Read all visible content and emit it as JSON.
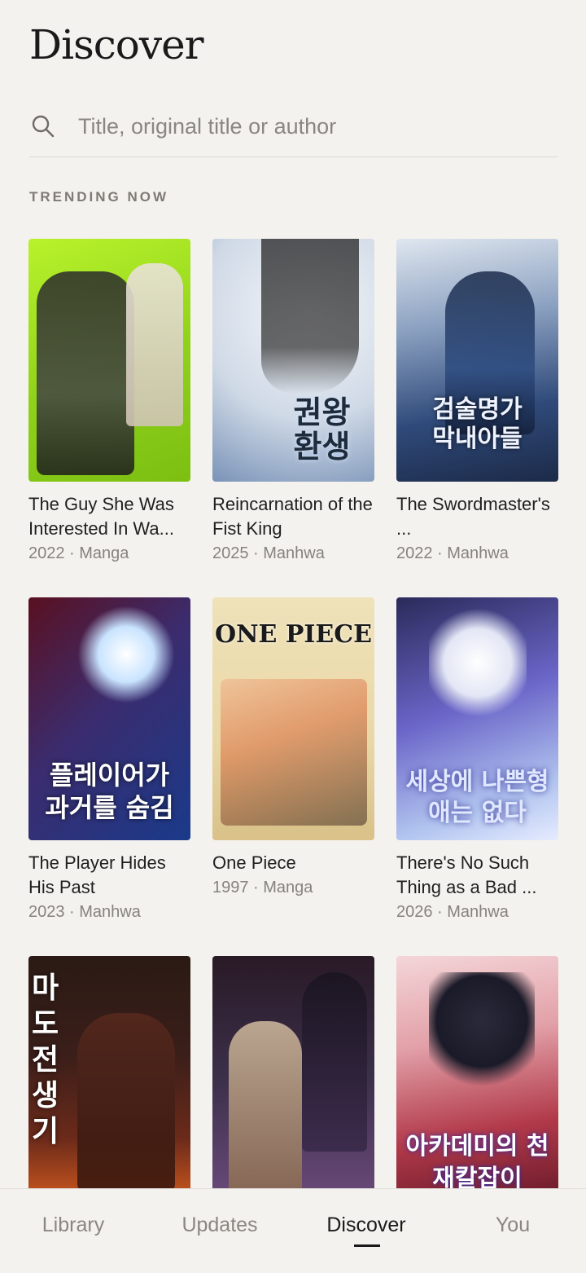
{
  "header": {
    "title": "Discover"
  },
  "search": {
    "placeholder": "Title, original title or author",
    "value": ""
  },
  "trending": {
    "label": "TRENDING NOW",
    "items": [
      {
        "title": "The Guy She Was Interested In Wasn't a Guy At All",
        "display_title": "The Guy She Was Interested In Wa...",
        "year": "2022",
        "type": "Manga",
        "meta": "2022 · Manga",
        "cover_text": ""
      },
      {
        "title": "Reincarnation of the Fist King",
        "display_title": "Reincarnation of the Fist King",
        "year": "2025",
        "type": "Manhwa",
        "meta": "2025 · Manhwa",
        "cover_text": "권왕 환생"
      },
      {
        "title": "The Swordmaster's Son",
        "display_title": "The Swordmaster's ...",
        "year": "2022",
        "type": "Manhwa",
        "meta": "2022 · Manhwa",
        "cover_text": "검술명가 막내아들"
      },
      {
        "title": "The Player Hides His Past",
        "display_title": "The Player Hides His Past",
        "year": "2023",
        "type": "Manhwa",
        "meta": "2023 · Manhwa",
        "cover_text": "플레이어가 과거를 숨김"
      },
      {
        "title": "One Piece",
        "display_title": "One Piece",
        "year": "1997",
        "type": "Manga",
        "meta": "1997 · Manga",
        "cover_text": "ONE PIECE"
      },
      {
        "title": "There's No Such Thing as a Bad Hero in the World",
        "display_title": "There's No Such Thing as a Bad ...",
        "year": "2026",
        "type": "Manhwa",
        "meta": "2026 · Manhwa",
        "cover_text": "세상에 나쁜형애는 없다"
      },
      {
        "title": "",
        "display_title": "",
        "year": "",
        "type": "",
        "meta": "",
        "cover_text": "마도전생기"
      },
      {
        "title": "",
        "display_title": "",
        "year": "",
        "type": "",
        "meta": "",
        "cover_text": ""
      },
      {
        "title": "",
        "display_title": "",
        "year": "",
        "type": "",
        "meta": "",
        "cover_text": "아카데미의 천재칼잡이"
      }
    ]
  },
  "tabs": [
    {
      "label": "Library",
      "active": false
    },
    {
      "label": "Updates",
      "active": false
    },
    {
      "label": "Discover",
      "active": true
    },
    {
      "label": "You",
      "active": false
    }
  ],
  "colors": {
    "background": "#f4f2ee",
    "text_primary": "#1a1a1a",
    "text_secondary": "#86837e",
    "cover_1": "#9be01a",
    "cover_2": "#dfe6ee",
    "cover_3": "#2f4a7a",
    "cover_4": "#3b2c6e",
    "cover_5": "#e9d7a6",
    "cover_6": "#6b66c9",
    "cover_7": "#3a1e1a",
    "cover_8": "#3b2f4a",
    "cover_9": "#b23a4a"
  },
  "icons": {
    "search": "search-icon"
  }
}
